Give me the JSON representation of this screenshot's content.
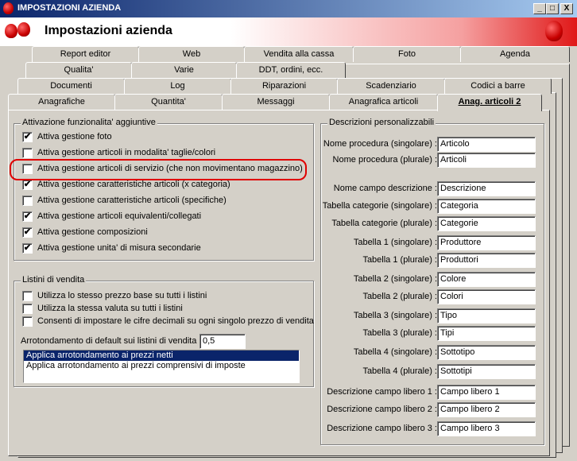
{
  "window": {
    "title": "IMPOSTAZIONI AZIENDA",
    "header_title": "Impostazioni azienda",
    "min_label": "_",
    "max_label": "□",
    "close_label": "X"
  },
  "tabs": {
    "row1": [
      "Report editor",
      "Web",
      "Vendita alla cassa",
      "Foto",
      "Agenda"
    ],
    "row2": [
      "Qualita'",
      "Varie",
      "DDT, ordini, ecc."
    ],
    "row3": [
      "Documenti",
      "Log",
      "Riparazioni",
      "Scadenziario",
      "Codici a barre"
    ],
    "row4": [
      "Anagrafiche",
      "Quantita'",
      "Messaggi",
      "Anagrafica articoli",
      "Anag. articoli 2"
    ]
  },
  "features": {
    "title": "Attivazione funzionalita' aggiuntive",
    "items": [
      {
        "label": "Attiva gestione foto",
        "checked": "✔"
      },
      {
        "label": "Attiva gestione articoli in modalita' taglie/colori",
        "checked": ""
      },
      {
        "label": "Attiva gestione articoli di servizio (che non movimentano magazzino)",
        "checked": ""
      },
      {
        "label": "Attiva gestione caratteristiche articoli (x categoria)",
        "checked": "✔"
      },
      {
        "label": "Attiva gestione caratteristiche articoli (specifiche)",
        "checked": ""
      },
      {
        "label": "Attiva gestione articoli equivalenti/collegati",
        "checked": "✔"
      },
      {
        "label": "Attiva gestione composizioni",
        "checked": "✔"
      },
      {
        "label": "Attiva gestione unita' di misura secondarie",
        "checked": "✔"
      }
    ]
  },
  "listini": {
    "title": "Listini di vendita",
    "items": [
      {
        "label": "Utilizza lo stesso prezzo base su tutti i listini",
        "checked": ""
      },
      {
        "label": "Utilizza la stessa valuta su tutti i listini",
        "checked": ""
      },
      {
        "label": "Consenti di impostare le cifre decimali su ogni singolo prezzo di vendita",
        "checked": ""
      }
    ],
    "rounding_label": "Arrotondamento di default sui listini di vendita :",
    "rounding_value": "0,5",
    "options": [
      "Applica arrotondamento ai prezzi netti",
      "Applica arrotondamento ai prezzi comprensivi di imposte"
    ]
  },
  "descr": {
    "title": "Descrizioni personalizzabili",
    "fields": [
      {
        "label": "Nome procedura (singolare) :",
        "value": "Articolo"
      },
      {
        "label": "Nome procedura (plurale) :",
        "value": "Articoli"
      },
      {
        "label": "Nome campo descrizione :",
        "value": "Descrizione"
      },
      {
        "label": "Tabella categorie (singolare) :",
        "value": "Categoria"
      },
      {
        "label": "Tabella categorie (plurale) :",
        "value": "Categorie"
      },
      {
        "label": "Tabella 1 (singolare) :",
        "value": "Produttore"
      },
      {
        "label": "Tabella 1 (plurale) :",
        "value": "Produttori"
      },
      {
        "label": "Tabella 2 (singolare) :",
        "value": "Colore"
      },
      {
        "label": "Tabella 2 (plurale) :",
        "value": "Colori"
      },
      {
        "label": "Tabella 3 (singolare) :",
        "value": "Tipo"
      },
      {
        "label": "Tabella 3 (plurale) :",
        "value": "Tipi"
      },
      {
        "label": "Tabella 4 (singolare) :",
        "value": "Sottotipo"
      },
      {
        "label": "Tabella 4 (plurale) :",
        "value": "Sottotipi"
      },
      {
        "label": "Descrizione campo libero 1 :",
        "value": "Campo libero 1"
      },
      {
        "label": "Descrizione campo libero 2 :",
        "value": "Campo libero 2"
      },
      {
        "label": "Descrizione campo libero 3 :",
        "value": "Campo libero 3"
      }
    ]
  }
}
